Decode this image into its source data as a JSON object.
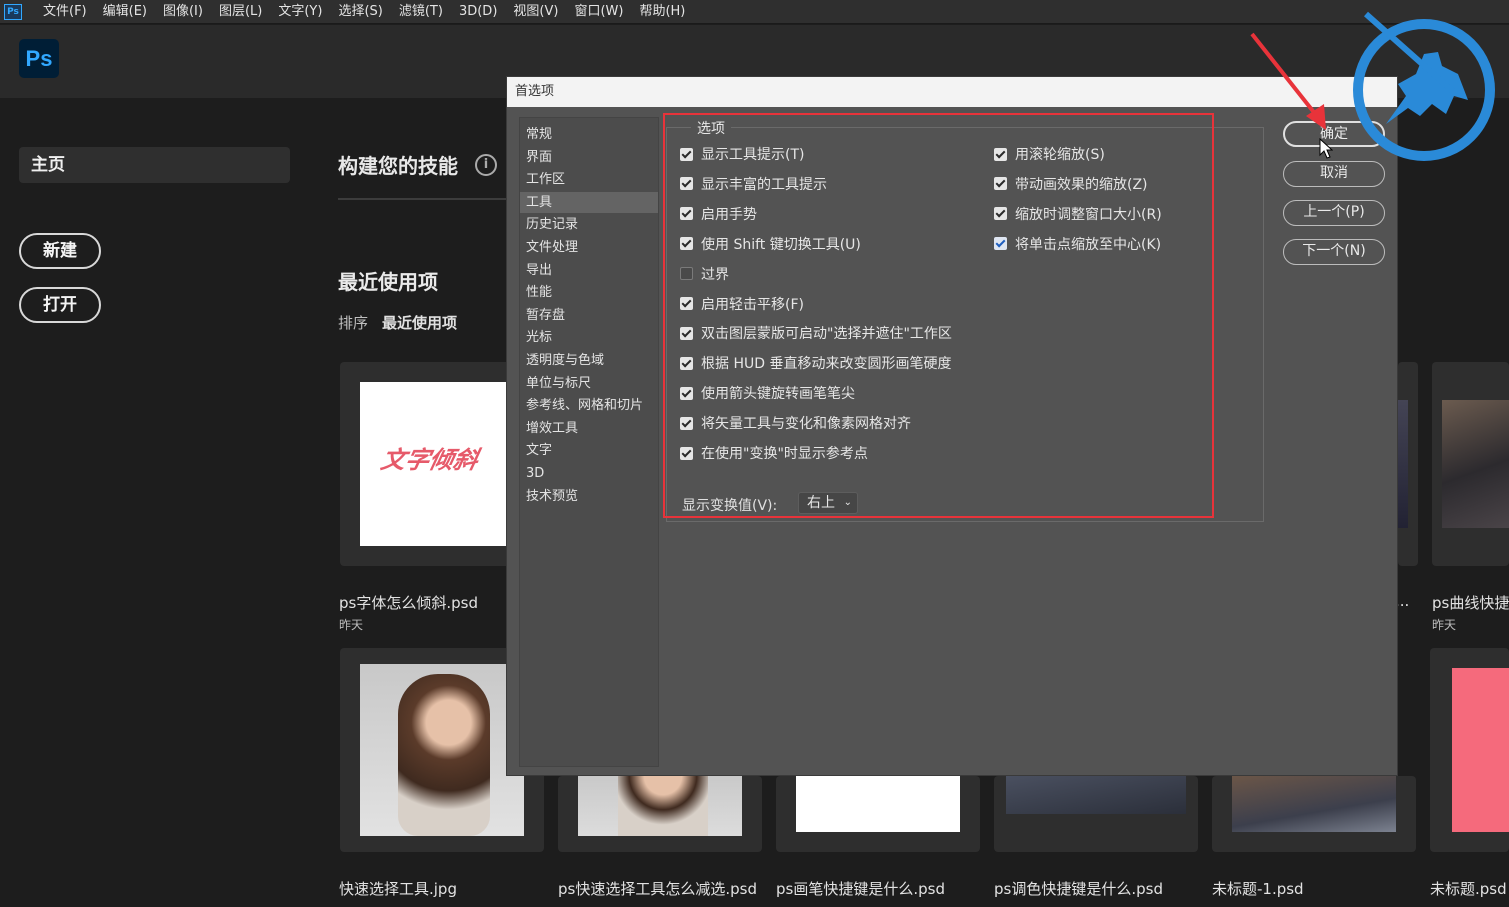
{
  "menubar": {
    "app_icon": "Ps",
    "items": [
      "文件(F)",
      "编辑(E)",
      "图像(I)",
      "图层(L)",
      "文字(Y)",
      "选择(S)",
      "滤镜(T)",
      "3D(D)",
      "视图(V)",
      "窗口(W)",
      "帮助(H)"
    ]
  },
  "header": {
    "logo": "Ps"
  },
  "sidebar": {
    "home": "主页",
    "new_button": "新建",
    "open_button": "打开"
  },
  "main": {
    "build_skills": "构建您的技能",
    "info_icon": "i",
    "recent_title": "最近使用项",
    "sort_label": "排序",
    "sort_value": "最近使用项",
    "files_row1": [
      {
        "name": "ps字体怎么倾斜.psd",
        "date": "昨天",
        "thumb_text": "文字倾斜"
      },
      {
        "name": "...",
        "date": ""
      },
      {
        "name": "ps曲线快捷",
        "date": "昨天"
      }
    ],
    "files_row2": [
      {
        "name": "快速选择工具.jpg"
      },
      {
        "name": "ps快速选择工具怎么减选.psd"
      },
      {
        "name": "ps画笔快捷键是什么.psd"
      },
      {
        "name": "ps调色快捷键是什么.psd"
      },
      {
        "name": "未标题-1.psd"
      },
      {
        "name": "未标题.psd"
      }
    ]
  },
  "dialog": {
    "title": "首选项",
    "categories": [
      "常规",
      "界面",
      "工作区",
      "工具",
      "历史记录",
      "文件处理",
      "导出",
      "性能",
      "暂存盘",
      "光标",
      "透明度与色域",
      "单位与标尺",
      "参考线、网格和切片",
      "增效工具",
      "文字",
      "3D",
      "技术预览"
    ],
    "active_category": "工具",
    "group_title": "选项",
    "options_left": [
      {
        "label": "显示工具提示(T)",
        "checked": true
      },
      {
        "label": "显示丰富的工具提示",
        "checked": true
      },
      {
        "label": "启用手势",
        "checked": true
      },
      {
        "label": "使用 Shift 键切换工具(U)",
        "checked": true
      },
      {
        "label": "过界",
        "checked": false
      },
      {
        "label": "启用轻击平移(F)",
        "checked": true
      },
      {
        "label": "双击图层蒙版可启动\"选择并遮住\"工作区",
        "checked": true
      },
      {
        "label": "根据 HUD 垂直移动来改变圆形画笔硬度",
        "checked": true
      },
      {
        "label": "使用箭头键旋转画笔笔尖",
        "checked": true
      },
      {
        "label": "将矢量工具与变化和像素网格对齐",
        "checked": true
      },
      {
        "label": "在使用\"变换\"时显示参考点",
        "checked": true
      }
    ],
    "options_right": [
      {
        "label": "用滚轮缩放(S)",
        "checked": true
      },
      {
        "label": "带动画效果的缩放(Z)",
        "checked": true
      },
      {
        "label": "缩放时调整窗口大小(R)",
        "checked": true
      },
      {
        "label": "将单击点缩放至中心(K)",
        "checked": true
      }
    ],
    "transform_label": "显示变换值(V):",
    "transform_value": "右上",
    "buttons": {
      "ok": "确定",
      "cancel": "取消",
      "prev": "上一个(P)",
      "next": "下一个(N)"
    }
  },
  "colors": {
    "highlight_box": "#e8333a",
    "ps_blue": "#31a8ff"
  }
}
